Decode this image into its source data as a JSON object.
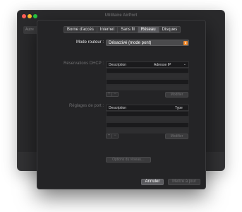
{
  "background_window": {
    "title": "Utilitaire AirPort",
    "sidebar_item": "Autre"
  },
  "tabs": [
    {
      "label": "Borne d'accès",
      "selected": false
    },
    {
      "label": "Internet",
      "selected": false
    },
    {
      "label": "Sans fil",
      "selected": false
    },
    {
      "label": "Réseau",
      "selected": true
    },
    {
      "label": "Disques",
      "selected": false
    }
  ],
  "router_mode": {
    "label": "Mode routeur :",
    "value": "Désactivé (mode pont)",
    "icon": "popup-chevron-icon",
    "accent": "#f08a2c"
  },
  "dhcp": {
    "label": "Réservations DHCP :",
    "columns": [
      "Description",
      "Adresse IP"
    ],
    "sort_icon": "chevron-down-icon",
    "rows": [],
    "add": "+",
    "remove": "−",
    "edit_button": "Modifier"
  },
  "port": {
    "label": "Réglages de port :",
    "columns": [
      "Description",
      "Type"
    ],
    "rows": [],
    "add": "+",
    "remove": "−",
    "edit_button": "Modifier"
  },
  "network_options_button": "Options du réseau…",
  "footer": {
    "cancel": "Annuler",
    "update": "Mettre à jour"
  }
}
